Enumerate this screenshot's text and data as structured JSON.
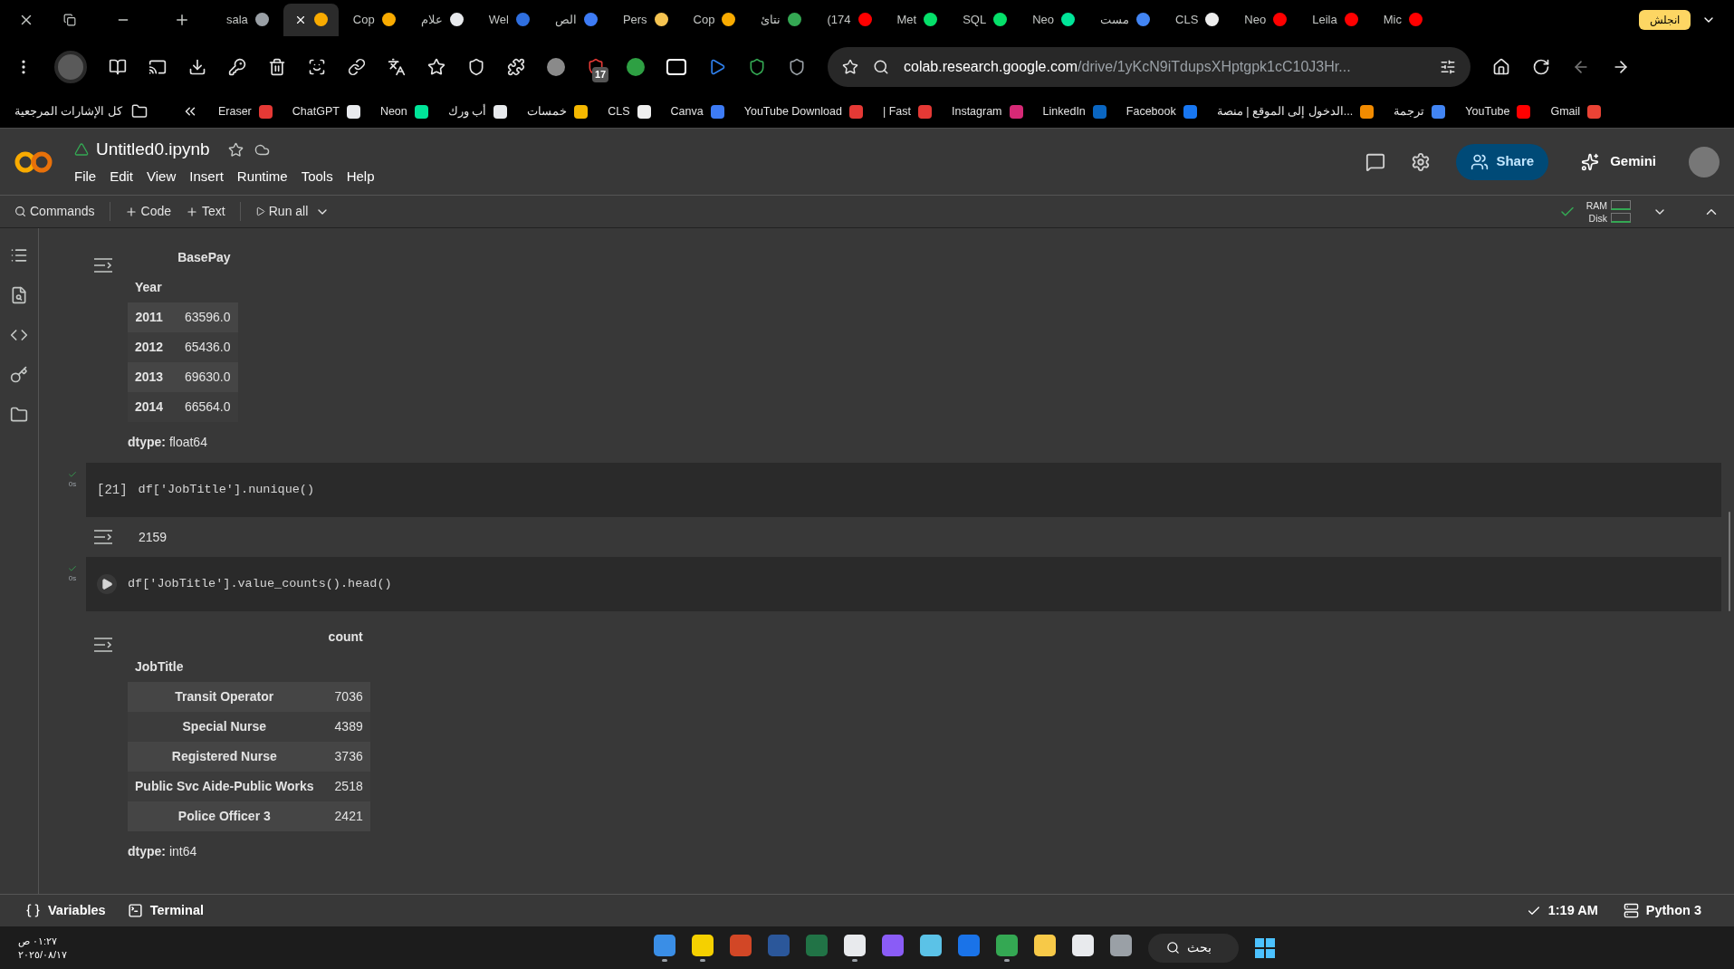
{
  "tabs": [
    {
      "label": "sala",
      "selected": false,
      "color": "#9aa0a6"
    },
    {
      "selected": true,
      "color": "#f9ab00"
    },
    {
      "label": "Cop",
      "selected": false,
      "color": "#f9ab00"
    },
    {
      "label": "علام",
      "selected": false,
      "color": "#e8eaed"
    },
    {
      "label": "Wel",
      "selected": false,
      "color": "#2f6fe0"
    },
    {
      "label": "الص",
      "selected": false,
      "color": "#3d7bf5"
    },
    {
      "label": "Pers",
      "selected": false,
      "color": "#f5c451"
    },
    {
      "label": "Cop",
      "selected": false,
      "color": "#f9ab00"
    },
    {
      "label": "نتائ",
      "selected": false,
      "color": "#34a853"
    },
    {
      "label": "(174",
      "selected": false,
      "color": "#ff0000"
    },
    {
      "label": "Met",
      "selected": false,
      "color": "#05e06a"
    },
    {
      "label": "SQL",
      "selected": false,
      "color": "#05e06a"
    },
    {
      "label": "Neo",
      "selected": false,
      "color": "#00e599"
    },
    {
      "label": "مست",
      "selected": false,
      "color": "#4285f4"
    },
    {
      "label": "CLS",
      "selected": false,
      "color": "#eeeeee"
    },
    {
      "label": "Neo",
      "selected": false,
      "color": "#ff0000"
    },
    {
      "label": "Leila",
      "selected": false,
      "color": "#ff0000"
    },
    {
      "label": "Mic",
      "selected": false,
      "color": "#ff0000"
    }
  ],
  "profile_chip": "انجلش",
  "extension_badge": "17",
  "address": {
    "host": "colab.research.google.com",
    "path": "/drive/1yKcN9iTdupsXHptgpk1cC10J3Hr..."
  },
  "bookmarks": {
    "all": "كل الإشارات المرجعية",
    "items": [
      {
        "label": "Eraser",
        "color": "#e53935"
      },
      {
        "label": "ChatGPT",
        "color": "#e8eaed"
      },
      {
        "label": "Neon",
        "color": "#00e599"
      },
      {
        "label": "أب ورك",
        "color": "#e8eaed"
      },
      {
        "label": "خمسات",
        "color": "#f5b800"
      },
      {
        "label": "CLS",
        "color": "#eeeeee"
      },
      {
        "label": "Canva",
        "color": "#3d7bf5"
      },
      {
        "label": "YouTube Download",
        "color": "#e53935"
      },
      {
        "label": "| Fast",
        "color": "#e53935"
      },
      {
        "label": "Instagram",
        "color": "#d62976"
      },
      {
        "label": "LinkedIn",
        "color": "#0a66c2"
      },
      {
        "label": "Facebook",
        "color": "#1877f2"
      },
      {
        "label": "الدخول إلى الموقع | منصة...",
        "color": "#f28b00"
      },
      {
        "label": "ترجمة",
        "color": "#4285f4"
      },
      {
        "label": "YouTube",
        "color": "#ff0000"
      },
      {
        "label": "Gmail",
        "color": "#ea4335"
      }
    ]
  },
  "notebook": {
    "title": "Untitled0.ipynb",
    "menu": [
      "File",
      "Edit",
      "View",
      "Insert",
      "Runtime",
      "Tools",
      "Help"
    ],
    "share": "Share",
    "gemini": "Gemini",
    "toolbar": {
      "commands": "Commands",
      "code": "Code",
      "text": "Text",
      "run_all": "Run all",
      "ram": "RAM",
      "disk": "Disk"
    }
  },
  "cells": [
    {
      "kind": "output_table",
      "header": "BasePay",
      "index_name": "Year",
      "rows": [
        [
          "2011",
          "63596.0"
        ],
        [
          "2012",
          "65436.0"
        ],
        [
          "2013",
          "69630.0"
        ],
        [
          "2014",
          "66564.0"
        ]
      ],
      "dtype": "dtype: float64"
    },
    {
      "kind": "code",
      "prompt": "[21]",
      "code": "df['JobTitle'].nunique()",
      "status": "0s"
    },
    {
      "kind": "output_text",
      "text": "2159"
    },
    {
      "kind": "code",
      "code": "df['JobTitle'].value_counts().head()",
      "status": "0s"
    },
    {
      "kind": "output_table",
      "header": "count",
      "index_name": "JobTitle",
      "rows": [
        [
          "Transit Operator",
          "7036"
        ],
        [
          "Special Nurse",
          "4389"
        ],
        [
          "Registered Nurse",
          "3736"
        ],
        [
          "Public Svc Aide-Public Works",
          "2518"
        ],
        [
          "Police Officer 3",
          "2421"
        ]
      ],
      "dtype": "dtype: int64"
    }
  ],
  "status_bar": {
    "variables": "Variables",
    "terminal": "Terminal",
    "time": "1:19 AM",
    "runtime": "Python 3"
  },
  "taskbar": {
    "time": "٠١:٢٧ ص",
    "date": "٢٠٢٥/٠٨/١٧",
    "search": "بحث",
    "apps": [
      {
        "color": "#3a8ee6",
        "running": true
      },
      {
        "color": "#f5d000",
        "running": true
      },
      {
        "color": "#d24726",
        "running": false
      },
      {
        "color": "#2b579a",
        "running": false
      },
      {
        "color": "#217346",
        "running": false
      },
      {
        "color": "#e8eaed",
        "running": true
      },
      {
        "color": "#8a5cf6",
        "running": false
      },
      {
        "color": "#5bc2e7",
        "running": false
      },
      {
        "color": "#1a73e8",
        "running": false
      },
      {
        "color": "#34a853",
        "running": true
      },
      {
        "color": "#f7c948",
        "running": false
      },
      {
        "color": "#e8eaed",
        "running": false
      },
      {
        "color": "#9aa0a6",
        "running": false
      }
    ]
  }
}
